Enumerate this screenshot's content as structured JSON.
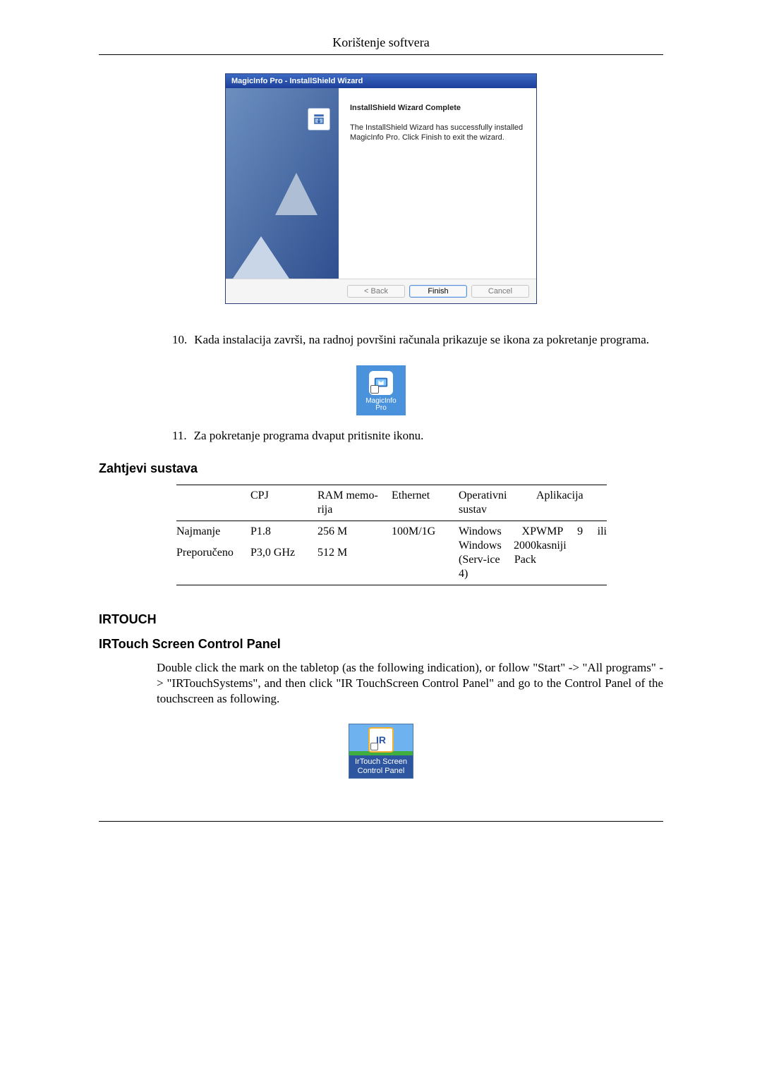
{
  "header": {
    "title": "Korištenje softvera"
  },
  "wizard": {
    "title": "MagicInfo Pro - InstallShield Wizard",
    "heading": "InstallShield Wizard Complete",
    "body": "The InstallShield Wizard has successfully installed MagicInfo Pro.  Click Finish to exit the wizard.",
    "buttons": {
      "back": "< Back",
      "finish": "Finish",
      "cancel": "Cancel"
    }
  },
  "list": {
    "item10_num": "10.",
    "item10": "Kada instalacija završi, na radnoj površini računala prikazuje se ikona za pokretanje programa.",
    "item11_num": "11.",
    "item11": "Za pokretanje programa dvaput pritisnite ikonu."
  },
  "desktop_icon": {
    "line1": "MagicInfo",
    "line2": "Pro"
  },
  "sections": {
    "sysreq": "Zahtjevi sustava",
    "irtouch": "IRTOUCH",
    "irtouch_sub": "IRTouch Screen Control Panel"
  },
  "table": {
    "headers": {
      "c1": "",
      "c2": "CPJ",
      "c3": "RAM memo-\nrija",
      "c4": "Ethernet",
      "c5": "Operativni sustav",
      "c6": "Aplikacija"
    },
    "rows": {
      "min": {
        "c1": "Najmanje",
        "c2": "P1.8",
        "c3": "256 M",
        "c4": "100M/1G"
      },
      "rec": {
        "c1": "Preporučeno",
        "c2": "P3,0 GHz",
        "c3": "512 M",
        "c4": ""
      },
      "os": "Windows XP Windows 2000 (Serv-ice Pack 4)",
      "app": "WMP 9 ili kasniji"
    }
  },
  "irtouch_para": "Double click the mark on the tabletop (as the following indication), or follow \"Start\" -> \"All programs\" -> \"IRTouchSystems\", and then click \"IR TouchScreen Control Panel\" and go to the Control Panel of the touchscreen as following.",
  "irtouch_icon": {
    "mark": "IR",
    "line1": "IrTouch Screen",
    "line2": "Control Panel"
  }
}
